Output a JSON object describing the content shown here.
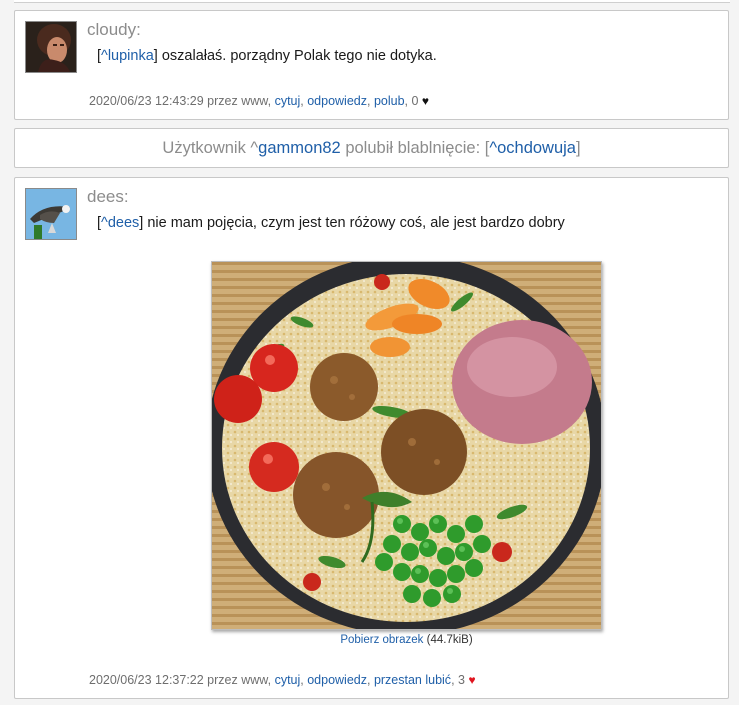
{
  "post1": {
    "username": "cloudy:",
    "mention": "^lupinka",
    "text": " oszalałaś. porządny Polak tego nie dotyka.",
    "timestamp": "2020/06/23 12:43:29",
    "by_text": " przez www, ",
    "action_quote": "cytuj",
    "action_reply": "odpowiedz",
    "action_like": "polub",
    "likes": "0"
  },
  "notice": {
    "prefix": "Użytkownik ^",
    "user": "gammon82",
    "middle": " polubił blablnięcie: [",
    "link": "^ochdowuja",
    "suffix": "]"
  },
  "post2": {
    "username": "dees:",
    "mention": "^dees",
    "text": " nie mam pojęcia, czym jest ten różowy coś, ale jest bardzo dobry",
    "image_link": "Pobierz obrazek",
    "image_size": " (44.7kiB)",
    "timestamp": "2020/06/23 12:37:22",
    "by_text": " przez www, ",
    "action_quote": "cytuj",
    "action_reply": "odpowiedz",
    "action_unlike": "przestan lubić",
    "likes": "3"
  },
  "colors": {
    "link": "#1f5fa8",
    "heart_liked": "#e0141e",
    "muted": "#8c8c8c"
  }
}
